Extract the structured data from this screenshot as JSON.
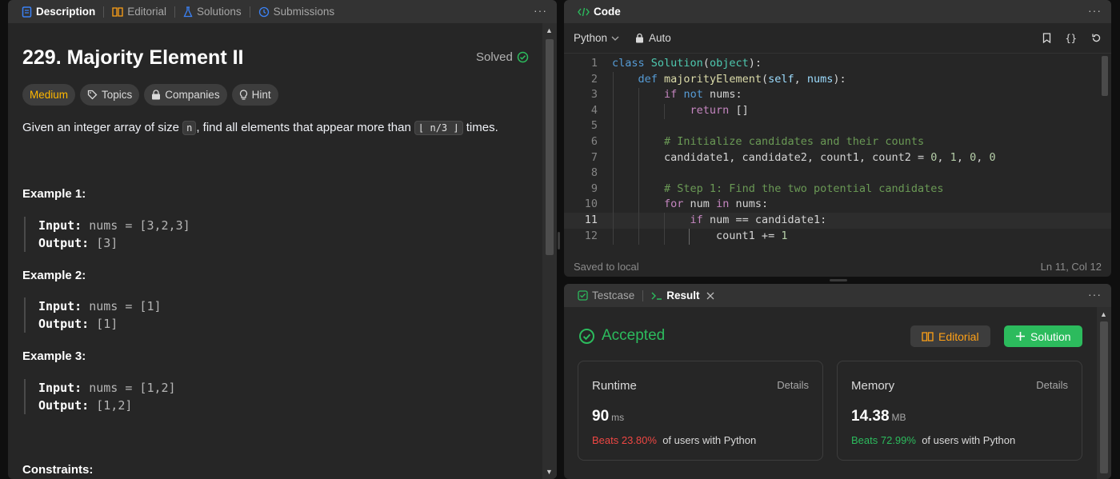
{
  "left_tabs": [
    {
      "label": "Description",
      "icon": "document-icon",
      "color": "#3b82f6"
    },
    {
      "label": "Editorial",
      "icon": "book-icon",
      "color": "#ffa116"
    },
    {
      "label": "Solutions",
      "icon": "flask-icon",
      "color": "#3b82f6"
    },
    {
      "label": "Submissions",
      "icon": "history-icon",
      "color": "#3b82f6"
    }
  ],
  "problem": {
    "title": "229. Majority Element II",
    "status": "Solved",
    "chips": [
      "Medium",
      "Topics",
      "Companies",
      "Hint"
    ],
    "statement_pre": "Given an integer array of size ",
    "statement_code1": "n",
    "statement_mid": ", find all elements that appear more than ",
    "statement_code2": "⌊ n/3 ⌋",
    "statement_post": " times.",
    "examples": [
      {
        "title": "Example 1:",
        "input_label": "Input:",
        "input": "nums = [3,2,3]",
        "output_label": "Output:",
        "output": "[3]"
      },
      {
        "title": "Example 2:",
        "input_label": "Input:",
        "input": "nums = [1]",
        "output_label": "Output:",
        "output": "[1]"
      },
      {
        "title": "Example 3:",
        "input_label": "Input:",
        "input": "nums = [1,2]",
        "output_label": "Output:",
        "output": "[1,2]"
      }
    ],
    "constraints_title": "Constraints:"
  },
  "code_panel": {
    "title": "Code",
    "language": "Python",
    "mode": "Auto",
    "status_left": "Saved to local",
    "status_right": "Ln 11, Col 12",
    "current_line": 11
  },
  "result_panel": {
    "tab_testcase": "Testcase",
    "tab_result": "Result",
    "verdict": "Accepted",
    "editorial_btn": "Editorial",
    "solution_btn": "Solution",
    "runtime": {
      "title": "Runtime",
      "details": "Details",
      "value": "90",
      "unit": "ms",
      "beats": "Beats 23.80%",
      "suffix": "of users with Python",
      "beats_color": "#ef4743"
    },
    "memory": {
      "title": "Memory",
      "details": "Details",
      "value": "14.38",
      "unit": "MB",
      "beats": "Beats 72.99%",
      "suffix": "of users with Python",
      "beats_color": "#2cbb5d"
    }
  }
}
